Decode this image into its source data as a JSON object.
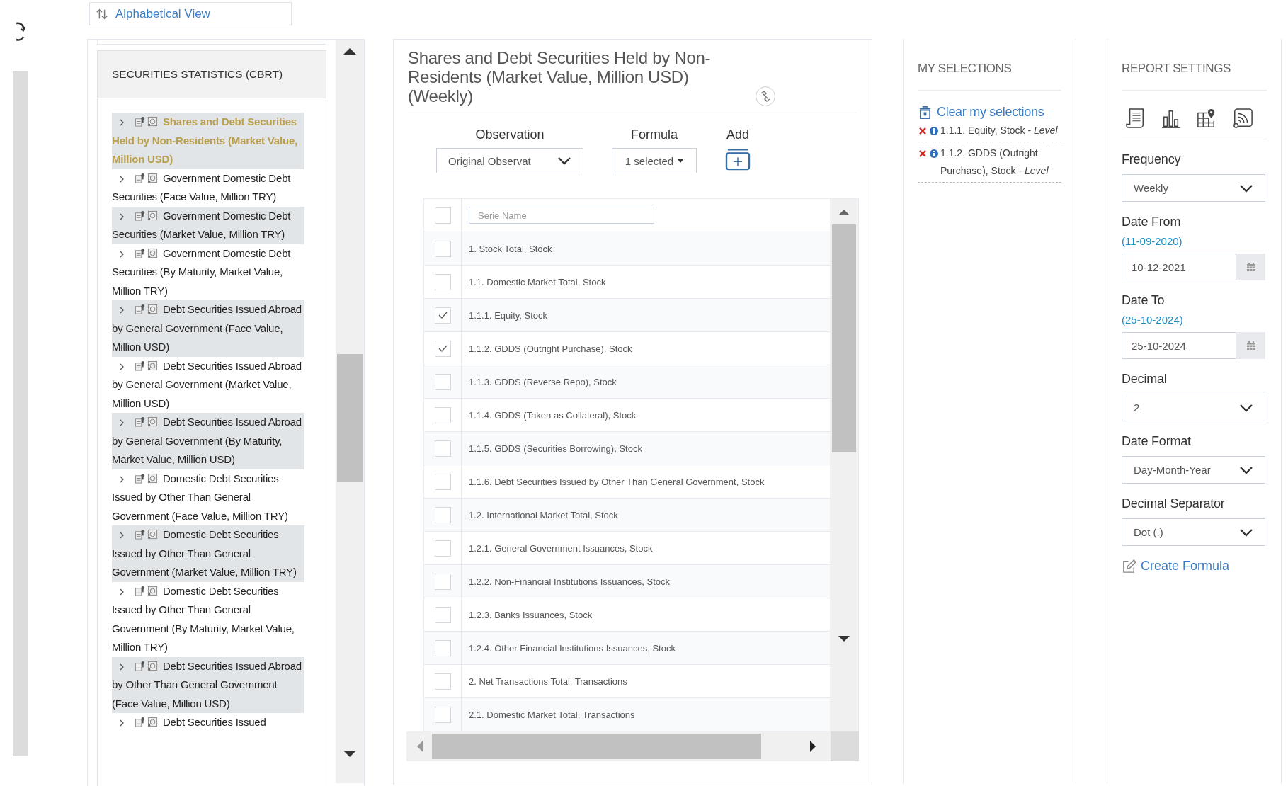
{
  "sort_button": {
    "label": "Alphabetical View"
  },
  "tree": {
    "header": "SECURITIES STATISTICS (CBRT)",
    "items": [
      {
        "label": "Shares and Debt Securities Held by Non-Residents (Market Value, Million USD)",
        "selected": true
      },
      {
        "label": "Government Domestic Debt Securities (Face Value, Million TRY)",
        "selected": false
      },
      {
        "label": "Government Domestic Debt Securities (Market Value, Million TRY)",
        "selected": false
      },
      {
        "label": "Government Domestic Debt Securities (By Maturity, Market Value, Million TRY)",
        "selected": false
      },
      {
        "label": "Debt Securities Issued Abroad by General Government (Face Value, Million USD)",
        "selected": false
      },
      {
        "label": "Debt Securities Issued Abroad by General Government (Market Value, Million USD)",
        "selected": false
      },
      {
        "label": "Debt Securities Issued Abroad by General Government (By Maturity, Market Value, Million USD)",
        "selected": false
      },
      {
        "label": "Domestic Debt Securities Issued by Other Than General Government (Face Value, Million TRY)",
        "selected": false
      },
      {
        "label": "Domestic Debt Securities Issued by Other Than General Government (Market Value, Million TRY)",
        "selected": false
      },
      {
        "label": "Domestic Debt Securities Issued by Other Than General Government (By Maturity, Market Value, Million TRY)",
        "selected": false
      },
      {
        "label": "Debt Securities Issued Abroad by Other Than General Government (Face Value, Million USD)",
        "selected": false
      },
      {
        "label": "Debt Securities Issued",
        "selected": false
      }
    ]
  },
  "main": {
    "title": "Shares and Debt Securities Held by Non-Residents (Market Value, Million USD)(Weekly)",
    "observation": {
      "label": "Observation",
      "value": "Original Observat"
    },
    "formula": {
      "label": "Formula",
      "value": "1 selected"
    },
    "add": {
      "label": "Add"
    },
    "table": {
      "placeholder": "Serie Name",
      "all_checked": false,
      "rows": [
        {
          "name": "1. Stock Total, Stock",
          "checked": false
        },
        {
          "name": "1.1. Domestic Market Total, Stock",
          "checked": false
        },
        {
          "name": "1.1.1. Equity, Stock",
          "checked": true
        },
        {
          "name": "1.1.2. GDDS (Outright Purchase), Stock",
          "checked": true
        },
        {
          "name": "1.1.3. GDDS (Reverse Repo), Stock",
          "checked": false
        },
        {
          "name": "1.1.4. GDDS (Taken as Collateral), Stock",
          "checked": false
        },
        {
          "name": "1.1.5. GDDS (Securities Borrowing), Stock",
          "checked": false
        },
        {
          "name": "1.1.6. Debt Securities Issued by Other Than General Government, Stock",
          "checked": false
        },
        {
          "name": "1.2. International Market Total, Stock",
          "checked": false
        },
        {
          "name": "1.2.1. General Government Issuances, Stock",
          "checked": false
        },
        {
          "name": "1.2.2. Non-Financial Institutions Issuances, Stock",
          "checked": false
        },
        {
          "name": "1.2.3. Banks Issuances, Stock",
          "checked": false
        },
        {
          "name": "1.2.4. Other Financial Institutions Issuances, Stock",
          "checked": false
        },
        {
          "name": "2. Net Transactions Total, Transactions",
          "checked": false
        },
        {
          "name": "2.1. Domestic Market Total, Transactions",
          "checked": false
        }
      ]
    }
  },
  "selections": {
    "header": "MY SELECTIONS",
    "clear": "Clear my selections",
    "items": [
      "1.1.1. Equity, Stock - *Level*",
      "1.1.2. GDDS (Outright Purchase), Stock - *Level*"
    ]
  },
  "settings": {
    "header": "REPORT SETTINGS",
    "fields": [
      {
        "kind": "select",
        "label": "Frequency",
        "value": "Weekly"
      },
      {
        "kind": "date",
        "label": "Date From",
        "hint": "(11-09-2020)",
        "value": "10-12-2021"
      },
      {
        "kind": "date",
        "label": "Date To",
        "hint": "(25-10-2024)",
        "value": "25-10-2024"
      },
      {
        "kind": "select",
        "label": "Decimal",
        "value": "2"
      },
      {
        "kind": "select",
        "label": "Date Format",
        "value": "Day-Month-Year"
      },
      {
        "kind": "select",
        "label": "Decimal Separator",
        "value": "Dot (.)"
      }
    ],
    "create_formula": "Create Formula"
  }
}
